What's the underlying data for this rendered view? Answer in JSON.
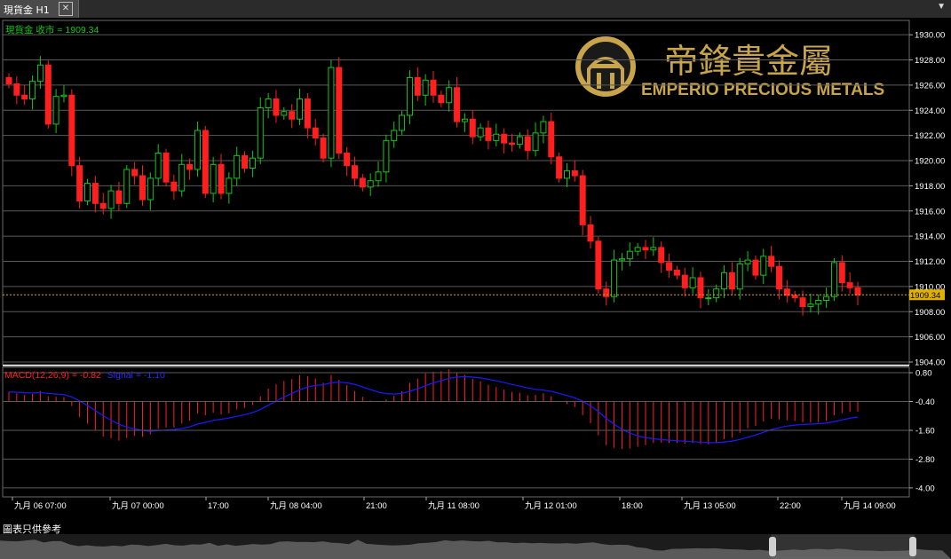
{
  "window": {
    "tab_title": "現貨金 H1",
    "close_icon": "close-icon",
    "menu_icon": "menu-arrow-icon"
  },
  "main_panel": {
    "label": "現貨金 收市 = 1909.34",
    "current_price": "1909.34",
    "y_ticks": [
      "1930.00",
      "1928.00",
      "1926.00",
      "1924.00",
      "1922.00",
      "1920.00",
      "1918.00",
      "1916.00",
      "1914.00",
      "1912.00",
      "1910.00",
      "1908.00",
      "1906.00",
      "1904.00"
    ]
  },
  "macd_panel": {
    "label_macd": "MACD(12,26,9) = -0.82",
    "label_signal": "Signal = -1.10",
    "y_ticks": [
      "0.80",
      "-0.40",
      "-1.60",
      "-2.80",
      "-4.00"
    ]
  },
  "x_labels": [
    "九月 06 07:00",
    "九月 07 00:00",
    "17:00",
    "九月 08 04:00",
    "21:00",
    "九月 11 08:00",
    "九月 12 01:00",
    "18:00",
    "九月 13 05:00",
    "22:00",
    "九月 14 09:00"
  ],
  "logo": {
    "chinese": "帝鋒貴金屬",
    "english": "EMPERIO PRECIOUS METALS"
  },
  "footer": {
    "caption": "圖表只供參考"
  },
  "colors": {
    "up": "#16c616",
    "down": "#ff1f1f",
    "grid": "#5a5a5a",
    "price_line": "#e0b000",
    "signal": "#1a1aff",
    "macd": "#ff2020",
    "gold": "#c8a44a"
  },
  "chart_data": {
    "type": "candlestick",
    "title": "現貨金 H1",
    "ylim": [
      1904,
      1931
    ],
    "close": [
      1926.1,
      1925.2,
      1924.9,
      1926.3,
      1927.6,
      1922.9,
      1925.1,
      1925.2,
      1919.6,
      1916.8,
      1918.2,
      1916.6,
      1916.2,
      1917.6,
      1916.6,
      1919.3,
      1918.8,
      1916.9,
      1918.6,
      1920.6,
      1918.3,
      1917.6,
      1919.7,
      1919.3,
      1922.4,
      1917.4,
      1919.7,
      1917.4,
      1918.6,
      1920.4,
      1919.4,
      1920.2,
      1924.2,
      1924.9,
      1923.6,
      1923.9,
      1923.3,
      1924.9,
      1922.6,
      1921.8,
      1920.2,
      1927.4,
      1920.6,
      1919.6,
      1918.6,
      1917.9,
      1918.4,
      1919.1,
      1921.6,
      1922.4,
      1923.6,
      1926.6,
      1925.2,
      1926.4,
      1925.2,
      1924.6,
      1925.8,
      1923.1,
      1923.3,
      1921.9,
      1922.6,
      1921.6,
      1922.1,
      1921.4,
      1921.3,
      1921.9,
      1920.8,
      1922.2,
      1923.1,
      1920.3,
      1918.6,
      1919.2,
      1918.8,
      1914.9,
      1913.6,
      1909.8,
      1909.2,
      1912.1,
      1912.2,
      1912.8,
      1913.1,
      1912.9,
      1913.1,
      1911.9,
      1911.3,
      1910.9,
      1909.9,
      1910.7,
      1909.1,
      1909.1,
      1909.8,
      1911.1,
      1909.8,
      1911.8,
      1912.1,
      1910.9,
      1912.4,
      1911.6,
      1909.8,
      1909.3,
      1909.1,
      1908.4,
      1908.6,
      1908.9,
      1909.2,
      1911.9,
      1910.3,
      1909.9,
      1909.34
    ],
    "macd": {
      "last": -0.82,
      "signal_last": -1.1,
      "ylim": [
        -4.3,
        0.95
      ]
    }
  }
}
